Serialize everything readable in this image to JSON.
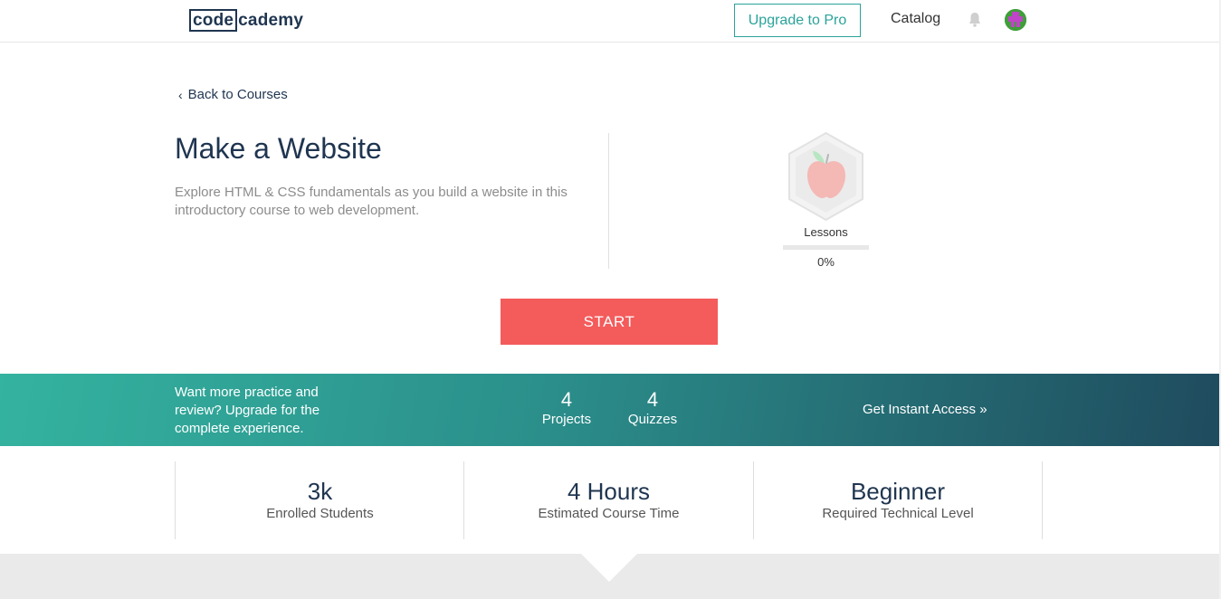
{
  "header": {
    "logo_box": "code",
    "logo_rest": "cademy",
    "upgrade_label": "Upgrade to Pro",
    "catalog_label": "Catalog"
  },
  "course": {
    "back_label": "Back to Courses",
    "title": "Make a Website",
    "description": "Explore HTML & CSS fundamentals as you build a website in this introductory course to web development.",
    "lessons_label": "Lessons",
    "progress_percent": 0,
    "progress_text": "0%",
    "start_label": "START"
  },
  "promo": {
    "text": "Want more practice and review? Upgrade for the complete experience.",
    "stats": [
      {
        "value": "4",
        "label": "Projects"
      },
      {
        "value": "4",
        "label": "Quizzes"
      }
    ],
    "cta": "Get Instant Access »"
  },
  "info": [
    {
      "value": "3k",
      "label": "Enrolled Students"
    },
    {
      "value": "4 Hours",
      "label": "Estimated Course Time"
    },
    {
      "value": "Beginner",
      "label": "Required Technical Level"
    }
  ],
  "colors": {
    "accent": "#2aa39a",
    "start": "#f45b5b",
    "navy": "#1f3550"
  },
  "icons": {
    "back": "chevron-left-icon",
    "bell": "bell-icon",
    "badge": "apple-icon"
  }
}
